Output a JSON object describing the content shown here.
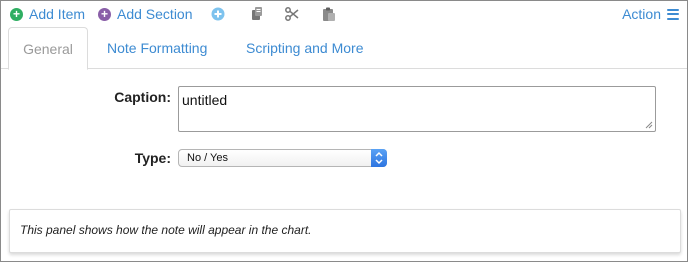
{
  "toolbar": {
    "add_item": "Add Item",
    "add_section": "Add Section",
    "action": "Action"
  },
  "tabs": [
    {
      "label": "General",
      "active": true
    },
    {
      "label": "Note Formatting",
      "active": false
    },
    {
      "label": "Scripting and More",
      "active": false
    }
  ],
  "form": {
    "caption_label": "Caption:",
    "caption_value": "untitled",
    "type_label": "Type:",
    "type_value": "No / Yes"
  },
  "preview": {
    "text": "This panel shows how the note will appear in the chart."
  },
  "colors": {
    "accent": "#3d8bd2",
    "add_item_icon": "#2fae62",
    "add_section_icon": "#8a5fa8",
    "select_arrow": "#2d74e0"
  }
}
